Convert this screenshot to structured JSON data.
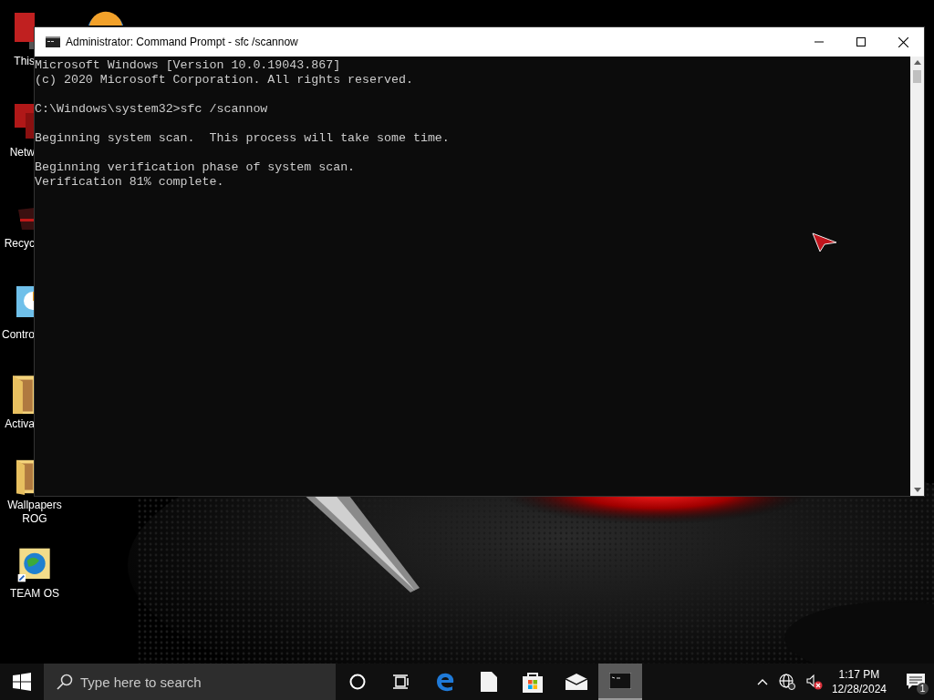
{
  "desktop_icons": [
    {
      "kind": "browser",
      "partly_hidden": true
    },
    {
      "kind": "monitor",
      "label": "This",
      "partly_hidden": true
    },
    {
      "kind": "network",
      "label": "Netw",
      "partly_hidden": true
    },
    {
      "kind": "bin",
      "label": "Recyc",
      "partly_hidden": true
    },
    {
      "kind": "control",
      "label": "Contro",
      "partly_hidden": true
    },
    {
      "kind": "folder",
      "label": "Activa",
      "partly_hidden": true
    },
    {
      "kind": "folder",
      "label": "Wallpapers ROG",
      "partly_hidden": false
    },
    {
      "kind": "globe",
      "label": "TEAM OS",
      "partly_hidden": false
    }
  ],
  "window": {
    "title": "Administrator: Command Prompt - sfc  /scannow",
    "console": [
      [
        "Microsoft Windows [Version 10.0.19043.867]",
        "(c) 2020 Microsoft Corporation. All rights reserved."
      ],
      [
        "C:\\Windows\\system32>sfc /scannow"
      ],
      [
        "Beginning system scan.  This process will take some time."
      ],
      [
        "Beginning verification phase of system scan.",
        "Verification 81% complete."
      ]
    ]
  },
  "taskbar": {
    "search": {
      "placeholder": "Type here to search"
    },
    "apps": [
      {
        "kind": "cortana",
        "selected": false
      },
      {
        "kind": "taskview",
        "selected": false
      },
      {
        "kind": "edge",
        "selected": false
      },
      {
        "kind": "file",
        "selected": false
      },
      {
        "kind": "store",
        "selected": false
      },
      {
        "kind": "mail",
        "selected": false
      },
      {
        "kind": "cmd",
        "selected": true
      }
    ],
    "time": "1:17 PM",
    "date": "12/28/2024",
    "notifications": "1"
  }
}
